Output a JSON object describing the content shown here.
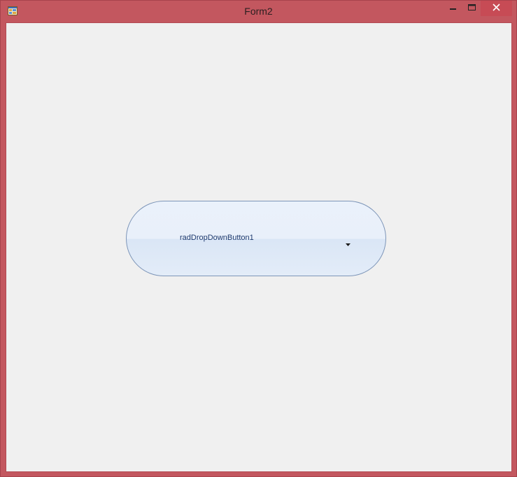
{
  "window": {
    "title": "Form2",
    "icon": "form-app-icon",
    "controls": {
      "minimize_icon": "minimize-icon",
      "maximize_icon": "maximize-icon",
      "close_icon": "close-icon"
    },
    "frame_color": "#c3575f",
    "client_background": "#f0f0f0"
  },
  "dropdown_button": {
    "label": "radDropDownButton1",
    "arrow_icon": "dropdown-arrow-icon",
    "text_color": "#1e3a6e",
    "border_color": "#7d95b8"
  }
}
